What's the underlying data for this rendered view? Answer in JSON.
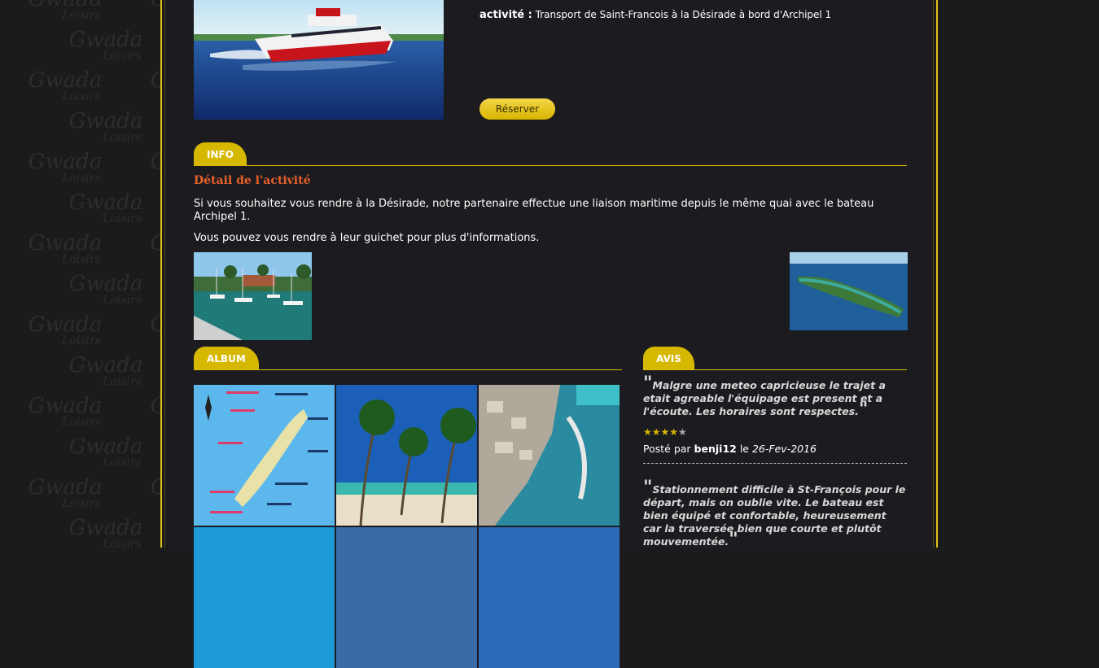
{
  "background": {
    "watermark_line1": "Gwada",
    "watermark_line2": "Loisirs"
  },
  "activity": {
    "label": "activité :",
    "value": "Transport de Saint-Francois à la Désirade à bord d'Archipel 1"
  },
  "reserve_button": "Réserver",
  "info": {
    "tab": "INFO",
    "detail_title": "Détail de l'activité",
    "paragraph1": "Si vous souhaitez vous rendre à  la Désirade, notre partenaire effectue une liaison maritime depuis le même quai avec le bateau Archipel 1.",
    "paragraph2": "Vous pouvez vous rendre à leur guichet pour plus d'informations."
  },
  "album": {
    "tab": "ALBUM"
  },
  "avis": {
    "tab": "AVIS",
    "reviews": [
      {
        "text": "Malgre une meteo capricieuse le trajet a etait agreable l'équipage est present et a l'écoute. Les horaires sont respectes.",
        "rating": 4,
        "posted_prefix": "Posté par",
        "author": "benji12",
        "date_prefix": "le",
        "date": "26-Fev-2016"
      },
      {
        "text": "Stationnement difficile à  St-François pour le départ, mais on oublie vite. Le bateau est bien équipé et confortable, heureusement car la traversée bien que courte et plutôt mouvementée."
      }
    ]
  },
  "colors": {
    "accent": "#d7b800",
    "title": "#e8612a",
    "background": "#1c1c20"
  }
}
